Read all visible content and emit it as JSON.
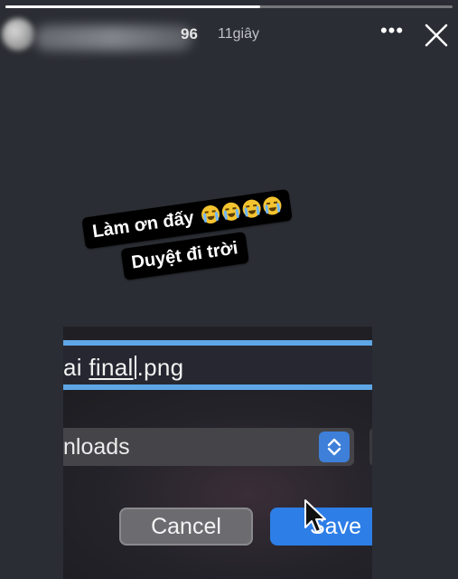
{
  "story": {
    "progress": 0.57,
    "username_visible": "96",
    "time_ago": "11giây",
    "more_icon": "more-horizontal-icon",
    "close_icon": "close-icon"
  },
  "sticker": {
    "line1": "Làm ơn đấy",
    "line2": "Duyệt đi trời",
    "emoji": "loudly-crying-face",
    "emoji_count": 4
  },
  "photo": {
    "filename_prefix": "ai ",
    "filename_selected": "final",
    "filename_ext": ".png",
    "location_text": "nloads",
    "cancel_label": "Cancel",
    "save_label": "Save"
  },
  "colors": {
    "background": "#2a2d33",
    "accent_blue": "#2d7ee6",
    "sticker_bg": "#000000"
  }
}
